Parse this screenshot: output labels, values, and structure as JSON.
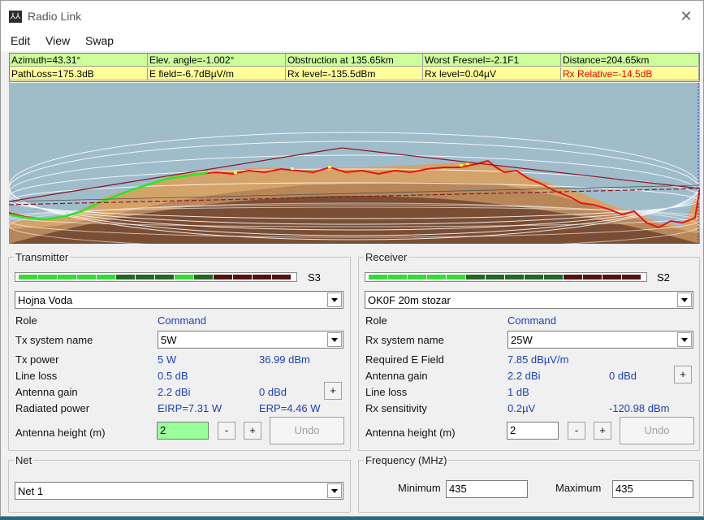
{
  "window": {
    "title": "Radio Link",
    "close_glyph": "✕",
    "icon_text": "⅄⅄"
  },
  "menu": [
    "Edit",
    "View",
    "Swap"
  ],
  "info": {
    "row1": [
      "Azimuth=43.31°",
      "Elev. angle=-1.002°",
      "Obstruction at 135.65km",
      "Worst Fresnel=-2.1F1",
      "Distance=204.65km"
    ],
    "row2": [
      "PathLoss=175.3dB",
      "E field=-6.7dBµV/m",
      "Rx level=-135.5dBm",
      "Rx level=0.04µV",
      "Rx Relative=-14.5dB"
    ]
  },
  "transmitter": {
    "title": "Transmitter",
    "signal": "S3",
    "meter_colors": [
      "#33dd33",
      "#33dd33",
      "#33dd33",
      "#33dd33",
      "#33dd33",
      "#226622",
      "#226622",
      "#226622",
      "#33dd33",
      "#226622",
      "#551111",
      "#551111",
      "#551111",
      "#551111"
    ],
    "station": "Hojna Voda",
    "role_label": "Role",
    "role_value": "Command",
    "system_label": "Tx system name",
    "system_value": "5W",
    "power_label": "Tx power",
    "power_w": "5 W",
    "power_dbm": "36.99 dBm",
    "line_loss_label": "Line loss",
    "line_loss_value": "0.5 dB",
    "gain_label": "Antenna gain",
    "gain_dbi": "2.2 dBi",
    "gain_dbd": "0 dBd",
    "radiated_label": "Radiated power",
    "eirp": "EIRP=7.31 W",
    "erp": "ERP=4.46 W",
    "height_label": "Antenna height (m)",
    "height_value": "2",
    "plus": "+",
    "minus": "-",
    "undo": "Undo"
  },
  "receiver": {
    "title": "Receiver",
    "signal": "S2",
    "meter_colors": [
      "#33dd33",
      "#33dd33",
      "#33dd33",
      "#33dd33",
      "#33dd33",
      "#226622",
      "#226622",
      "#226622",
      "#226622",
      "#226622",
      "#551111",
      "#551111",
      "#551111",
      "#551111"
    ],
    "station": "OK0F 20m stozar",
    "role_label": "Role",
    "role_value": "Command",
    "system_label": "Rx system name",
    "system_value": "25W",
    "field_label": "Required E Field",
    "field_value": "7.85 dBµV/m",
    "gain_label": "Antenna gain",
    "gain_dbi": "2.2 dBi",
    "gain_dbd": "0 dBd",
    "line_loss_label": "Line loss",
    "line_loss_value": "1 dB",
    "sens_label": "Rx sensitivity",
    "sens_uv": "0.2µV",
    "sens_dbm": "-120.98 dBm",
    "height_label": "Antenna height (m)",
    "height_value": "2",
    "plus": "+",
    "minus": "-",
    "undo": "Undo"
  },
  "net": {
    "title": "Net",
    "value": "Net 1"
  },
  "frequency": {
    "title": "Frequency (MHz)",
    "min_label": "Minimum",
    "min_value": "435",
    "max_label": "Maximum",
    "max_value": "435"
  }
}
